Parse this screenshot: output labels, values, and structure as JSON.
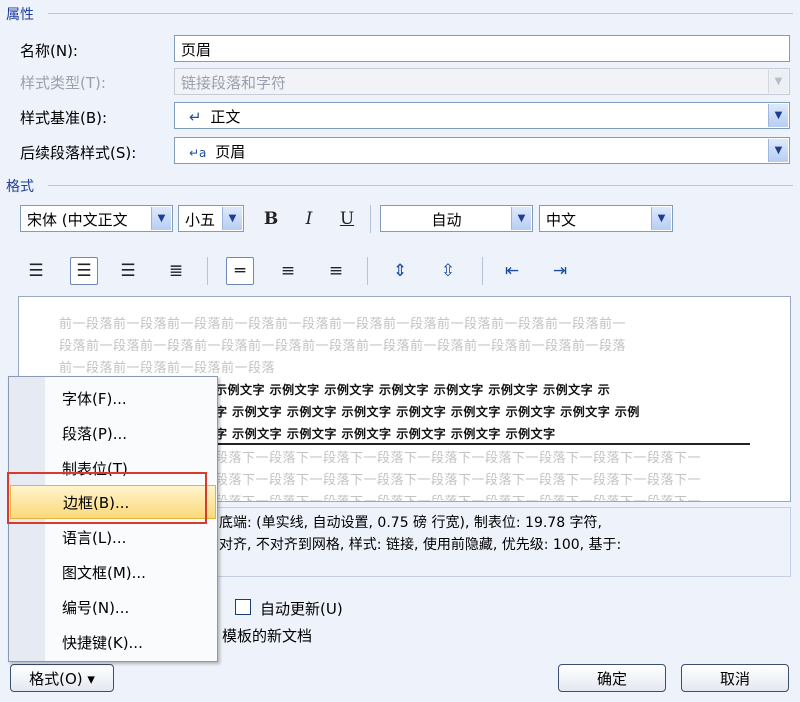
{
  "properties": {
    "title": "属性",
    "name_label": "名称(N):",
    "name_value": "页眉",
    "style_type_label": "样式类型(T):",
    "style_type_value": "链接段落和字符",
    "style_based_label": "样式基准(B):",
    "style_based_value": "正文",
    "next_style_label": "后续段落样式(S):",
    "next_style_value": "页眉"
  },
  "format": {
    "title": "格式",
    "font": "宋体 (中文正文",
    "size": "小五",
    "bold": "B",
    "italic": "I",
    "underline": "U",
    "color": "自动",
    "language": "中文"
  },
  "preview": {
    "prev_lines": [
      "前一段落前一段落前一段落前一段落前一段落前一段落前一段落前一段落前一段落前一段落前一",
      "段落前一段落前一段落前一段落前一段落前一段落前一段落前一段落前一段落前一段落前一段落",
      "前一段落前一段落前一段落前一段落"
    ],
    "sample_lines": [
      "示例文字  示例文字  示例文字  示例文字  示例文字  示例文字  示例文字  示",
      "字  示例文字  示例文字  示例文字  示例文字  示例文字  示例文字  示例文字  示例",
      "字  示例文字  示例文字  示例文字  示例文字  示例文字  示例文字"
    ],
    "next_lines": [
      "段落下一段落下一段落下一段落下一段落下一段落下一段落下一段落下一段落下一",
      "段落下一段落下一段落下一段落下一段落下一段落下一段落下一段落下一段落下一",
      "段落下一段落下一段落下一段落下一段落下一段落下一段落下一段落下一段落下一"
    ]
  },
  "description": {
    "line1": "底端: (单实线, 自动设置, 0.75 磅 行宽), 制表位: 19.78 字符,",
    "line2": "对齐, 不对齐到网格, 样式: 链接, 使用前隐藏, 优先级: 100, 基于:"
  },
  "options": {
    "auto_update_label": "自动更新(U)",
    "new_doc_label": "模板的新文档"
  },
  "menu": {
    "items": [
      {
        "label": "字体(F)..."
      },
      {
        "label": "段落(P)..."
      },
      {
        "label": "制表位(T)..."
      },
      {
        "label": "边框(B)..."
      },
      {
        "label": "语言(L)..."
      },
      {
        "label": "图文框(M)..."
      },
      {
        "label": "编号(N)..."
      },
      {
        "label": "快捷键(K)..."
      }
    ]
  },
  "buttons": {
    "format": "格式(O) ▾",
    "ok": "确定",
    "cancel": "取消"
  }
}
